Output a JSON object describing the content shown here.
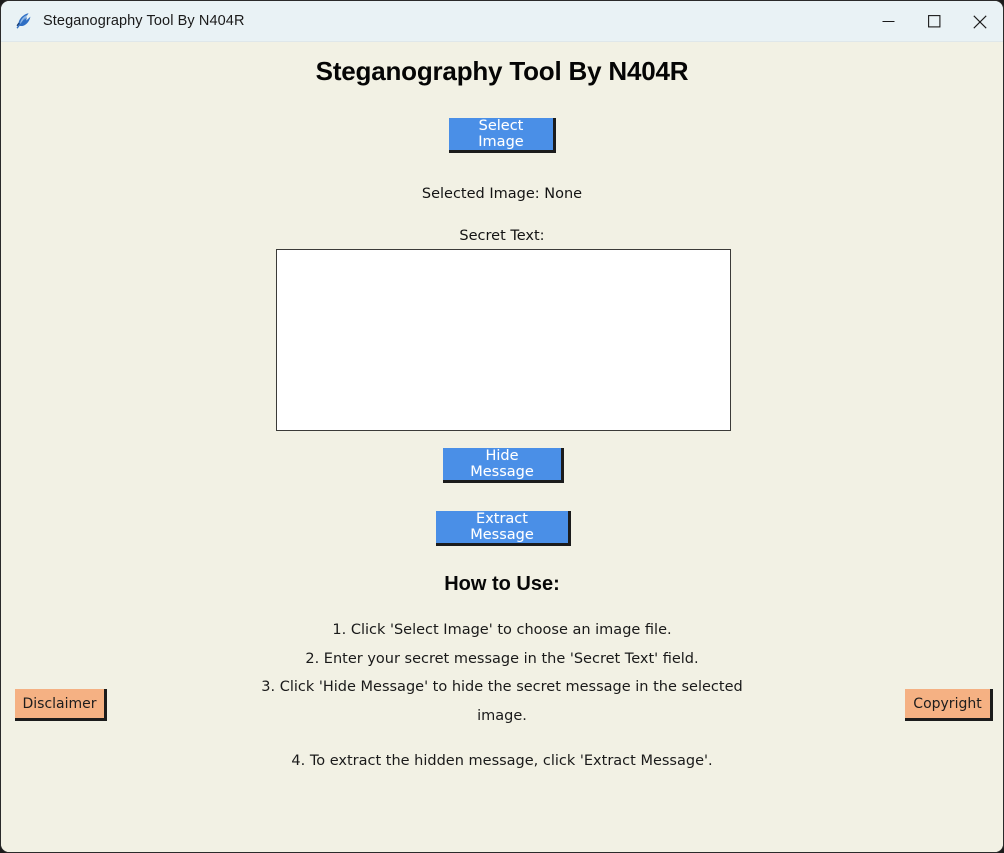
{
  "window": {
    "title": "Steganography Tool By N404R",
    "icon": "feather-icon",
    "controls": [
      {
        "name": "minimize-button",
        "icon": "minimize-icon",
        "label": "—"
      },
      {
        "name": "maximize-button",
        "icon": "maximize-icon",
        "label": "□"
      },
      {
        "name": "close-button",
        "icon": "close-icon",
        "label": "✕"
      }
    ],
    "colors": {
      "titlebar_bg": "#e9f2f5",
      "client_bg": "#f2f1e4",
      "accent_blue": "#4a8fe7",
      "accent_orange": "#f5b183",
      "border_dark": "#1c1c1c"
    }
  },
  "main": {
    "heading": "Steganography Tool By N404R",
    "select_image_label": "Select Image",
    "selected_image_status": "Selected Image: None",
    "secret_text_label": "Secret Text:",
    "secret_text_value": "",
    "secret_text_placeholder": "",
    "hide_message_label": "Hide Message",
    "extract_message_label": "Extract Message"
  },
  "howto": {
    "title": "How to Use:",
    "steps": [
      "1. Click 'Select Image' to choose an image file.",
      "2. Enter your secret message in the 'Secret Text' field.",
      "3. Click 'Hide Message' to hide the secret message in the selected image.",
      "4. To extract the hidden message, click 'Extract Message'."
    ]
  },
  "footer": {
    "disclaimer_label": "Disclaimer",
    "copyright_label": "Copyright"
  }
}
